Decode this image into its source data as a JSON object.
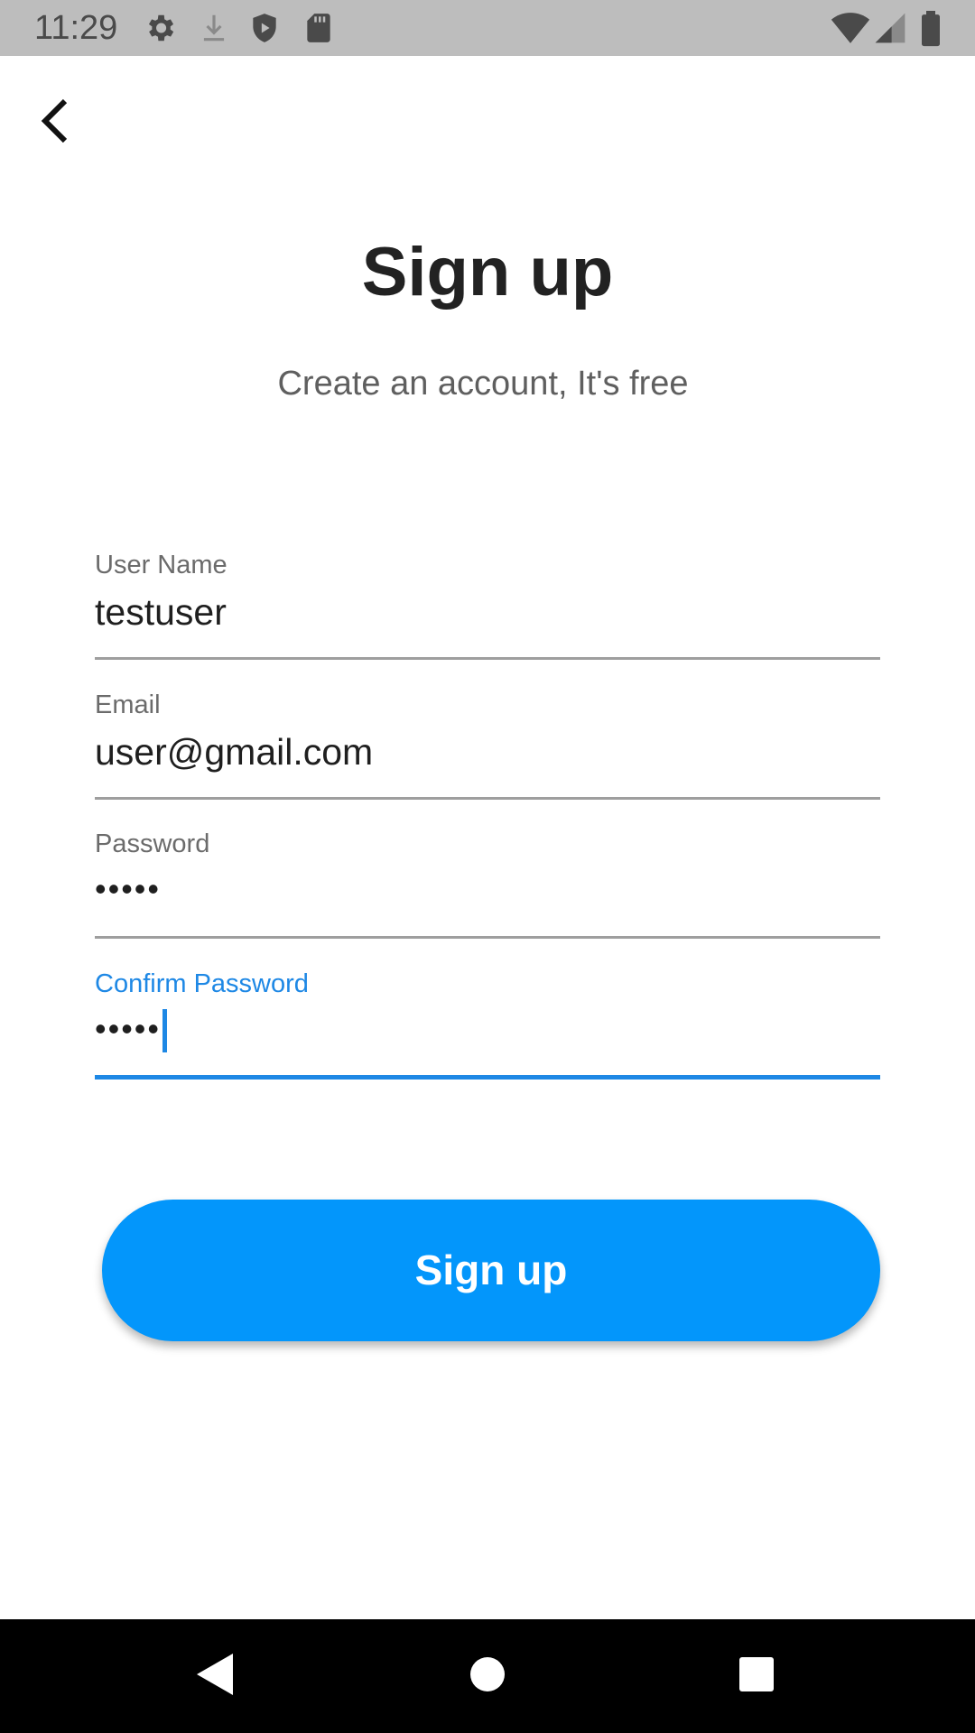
{
  "status_bar": {
    "time": "11:29",
    "icons": [
      "settings-icon",
      "download-icon",
      "shield-icon",
      "sd-card-icon",
      "wifi-icon",
      "signal-icon",
      "battery-icon"
    ]
  },
  "header": {
    "back_icon": "chevron-left-icon"
  },
  "main": {
    "title": "Sign up",
    "subtitle": "Create an account, It's free"
  },
  "form": {
    "username": {
      "label": "User Name",
      "value": "testuser"
    },
    "email": {
      "label": "Email",
      "value": "user@gmail.com"
    },
    "password": {
      "label": "Password",
      "value": "•••••"
    },
    "confirm_password": {
      "label": "Confirm Password",
      "value": "•••••"
    },
    "focused_field": "confirm_password"
  },
  "actions": {
    "signup_label": "Sign up"
  },
  "nav_bar": {
    "icons": [
      "back-triangle-icon",
      "home-circle-icon",
      "recents-square-icon"
    ]
  },
  "colors": {
    "accent": "#1e88e5",
    "button": "#0396fb",
    "status_bar": "#bdbdbd",
    "nav_bar": "#000000"
  }
}
